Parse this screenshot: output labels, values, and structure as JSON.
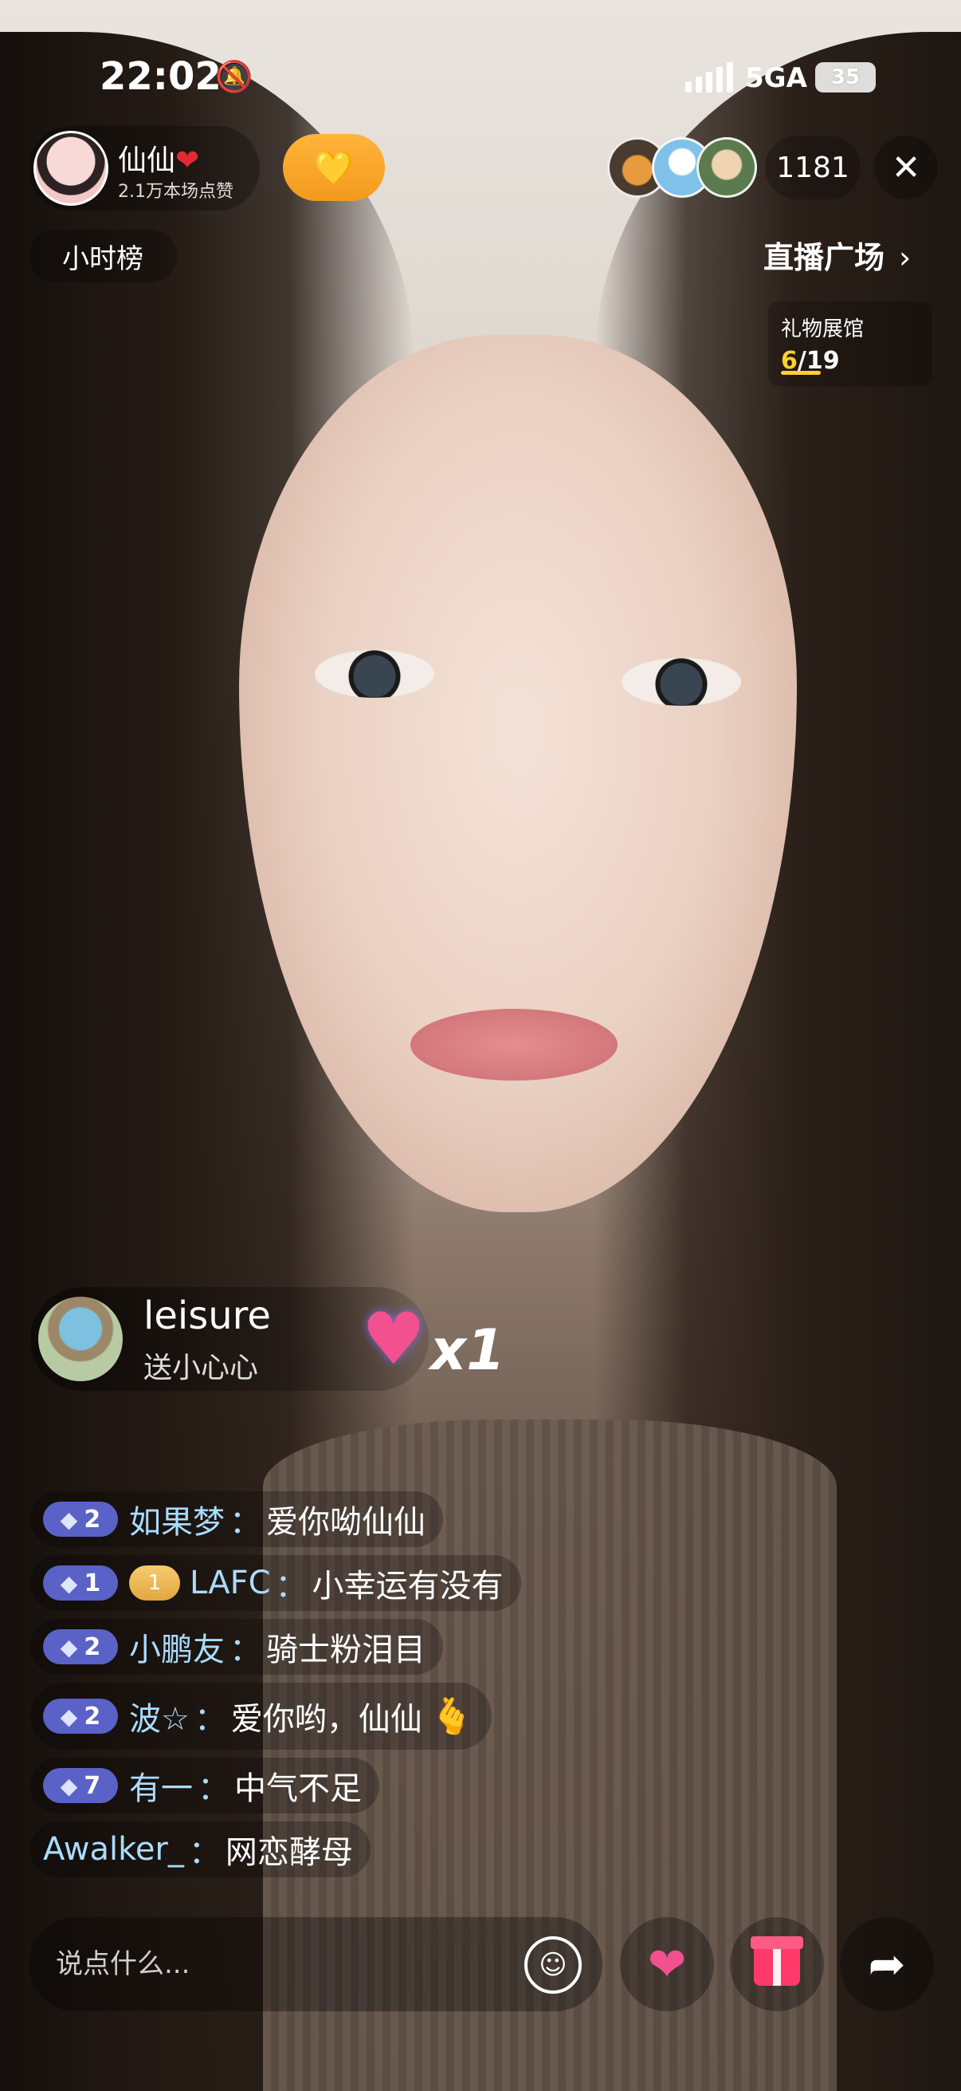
{
  "status_bar": {
    "time": "22:02",
    "network": "5GA",
    "battery": "35"
  },
  "host": {
    "name": "仙仙",
    "heart": "❤",
    "likes": "2.1万本场点赞"
  },
  "header": {
    "follow_icon": "heart-plus-icon",
    "viewer_count": "1181",
    "close": "✕",
    "hour_rank": "小时榜",
    "live_plaza": "直播广场",
    "live_plaza_chevron": "›"
  },
  "gift_gallery": {
    "title": "礼物展馆",
    "current": "6",
    "total": "/19"
  },
  "gift_notice": {
    "sender": "leisure",
    "action": "送小心心",
    "count": "x1"
  },
  "chat": [
    {
      "level": "2",
      "user": "如果梦",
      "sep": "：",
      "text": "爱你呦仙仙"
    },
    {
      "level": "1",
      "fan_badge": "1",
      "user": "LAFC",
      "sep": "：",
      "text": "小幸运有没有"
    },
    {
      "level": "2",
      "user": "小鹏友",
      "sep": "：",
      "text": "骑士粉泪目"
    },
    {
      "level": "2",
      "user": "波☆",
      "sep": "：",
      "text": "爱你哟，仙仙",
      "emoji": "🫰"
    },
    {
      "level": "7",
      "user": "有一",
      "sep": "：",
      "text": "中气不足"
    },
    {
      "user": "Awalker_",
      "sep": "：",
      "text": "网恋酵母"
    }
  ],
  "bottom_bar": {
    "input_placeholder": "说点什么...",
    "emoji": "☺",
    "heart": "❤",
    "share": "➦"
  },
  "colors": {
    "accent_orange": "#f39a1e",
    "level_badge": "#5a62c7",
    "chat_username": "#a9dcff",
    "gallery_highlight": "#ffcf33"
  }
}
